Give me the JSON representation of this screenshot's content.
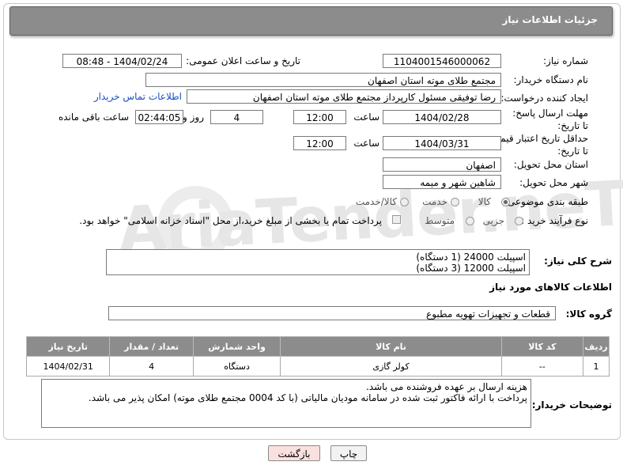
{
  "header": {
    "title": "جزئیات اطلاعات نیاز"
  },
  "watermark": {
    "text": "AriaTender.neT"
  },
  "fields": {
    "need_number_label": "شماره نیاز:",
    "need_number": "1104001546000062",
    "announce_label": "تاریخ و ساعت اعلان عمومی:",
    "announce_value": "1404/02/24 - 08:48",
    "buyer_org_label": "نام دستگاه خریدار:",
    "buyer_org": "مجتمع طلای موته استان اصفهان",
    "creator_label": "ایجاد کننده درخواست:",
    "creator": "رضا توفیقی مسئول کارپرداز مجتمع طلای موته استان اصفهان",
    "contact_link": "اطلاعات تماس خریدار",
    "reply_deadline_label": "مهلت ارسال پاسخ: تا تاریخ:",
    "reply_date": "1404/02/28",
    "time_label": "ساعت",
    "reply_time": "12:00",
    "days_count": "4",
    "days_label": "روز و",
    "remaining_time": "02:44:05",
    "remaining_label": "ساعت باقی مانده",
    "price_deadline_label": "حداقل تاریخ اعتبار قیمت: تا تاریخ:",
    "price_date": "1404/03/31",
    "price_time": "12:00",
    "province_label": "استان محل تحویل:",
    "province": "اصفهان",
    "city_label": "شهر محل تحویل:",
    "city": "شاهین شهر و میمه",
    "category_label": "طبقه بندی موضوعی:",
    "category_options": [
      "کالا",
      "خدمت",
      "کالا/خدمت"
    ],
    "process_label": "نوع فرآیند خرید :",
    "process_options": [
      "جزیی",
      "متوسط"
    ],
    "payment_note": "پرداخت تمام یا بخشی از مبلغ خرید،از محل \"اسناد خزانه اسلامی\" خواهد بود."
  },
  "description": {
    "label": "شرح کلی نیاز:",
    "text": "اسپیلت 24000 (1 دستگاه)\nاسپیلت 12000 (3 دستگاه)"
  },
  "items_section": {
    "title": "اطلاعات کالاهای مورد نیاز",
    "group_label": "گروه کالا:",
    "group_value": "قطعات و تجهیزات تهویه مطبوع"
  },
  "table": {
    "headers": [
      "ردیف",
      "کد کالا",
      "نام کالا",
      "واحد شمارش",
      "تعداد / مقدار",
      "تاریخ نیاز"
    ],
    "rows": [
      {
        "row": "1",
        "code": "--",
        "name": "کولر گازی",
        "unit": "دستگاه",
        "qty": "4",
        "date": "1404/02/31"
      }
    ]
  },
  "buyer_notes": {
    "label": "توضیحات خریدار:",
    "text": "هزینه ارسال بر عهده فروشنده می باشد.\nپرداخت با ارائه فاکتور ثبت شده در سامانه مودیان مالیاتی (با کد 0004 مجتمع طلای موته) امکان پذیر می باشد."
  },
  "buttons": {
    "print": "چاپ",
    "back": "بازگشت"
  }
}
